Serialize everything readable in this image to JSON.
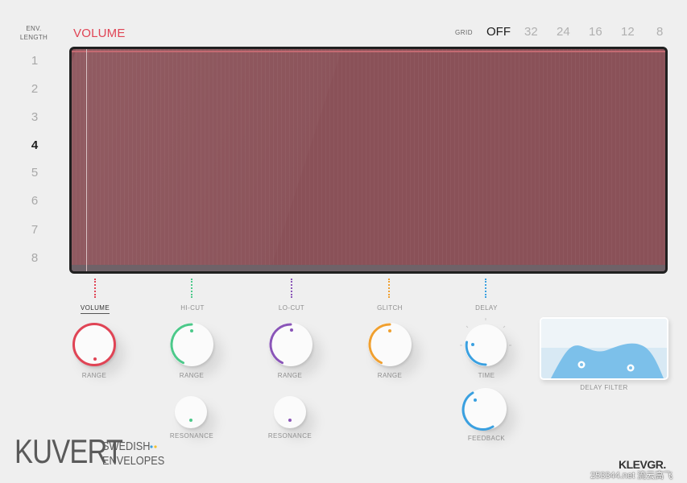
{
  "env_length": {
    "label_line1": "ENV.",
    "label_line2": "LENGTH",
    "options": [
      "1",
      "2",
      "3",
      "4",
      "5",
      "6",
      "7",
      "8"
    ],
    "selected": "4"
  },
  "header": {
    "title": "VOLUME",
    "grid_label": "GRID",
    "grid_options": [
      "OFF",
      "32",
      "24",
      "16",
      "12",
      "8"
    ],
    "grid_selected": "OFF"
  },
  "sections": [
    {
      "name": "VOLUME",
      "color": "#e04455",
      "knob_label": "RANGE",
      "second_label": ""
    },
    {
      "name": "HI-CUT",
      "color": "#4cc98a",
      "knob_label": "RANGE",
      "second_label": "RESONANCE"
    },
    {
      "name": "LO-CUT",
      "color": "#8a55b8",
      "knob_label": "RANGE",
      "second_label": "RESONANCE"
    },
    {
      "name": "GLITCH",
      "color": "#f0a030",
      "knob_label": "RANGE",
      "second_label": ""
    },
    {
      "name": "DELAY",
      "color": "#3aa0e0",
      "knob_label": "TIME",
      "second_label": "FEEDBACK"
    }
  ],
  "delay_filter": {
    "label": "DELAY FILTER",
    "color": "#7cc0ea"
  },
  "brand": {
    "name": "KUVERT",
    "sub_line1": "SWEDISH",
    "sub_line2": "ENVELOPES",
    "company": "KLEVGR.",
    "watermark": "253344.net 流云高飞"
  },
  "colors": {
    "accent": "#e04455",
    "display_fill": "#8a5158",
    "display_border": "#202020"
  }
}
